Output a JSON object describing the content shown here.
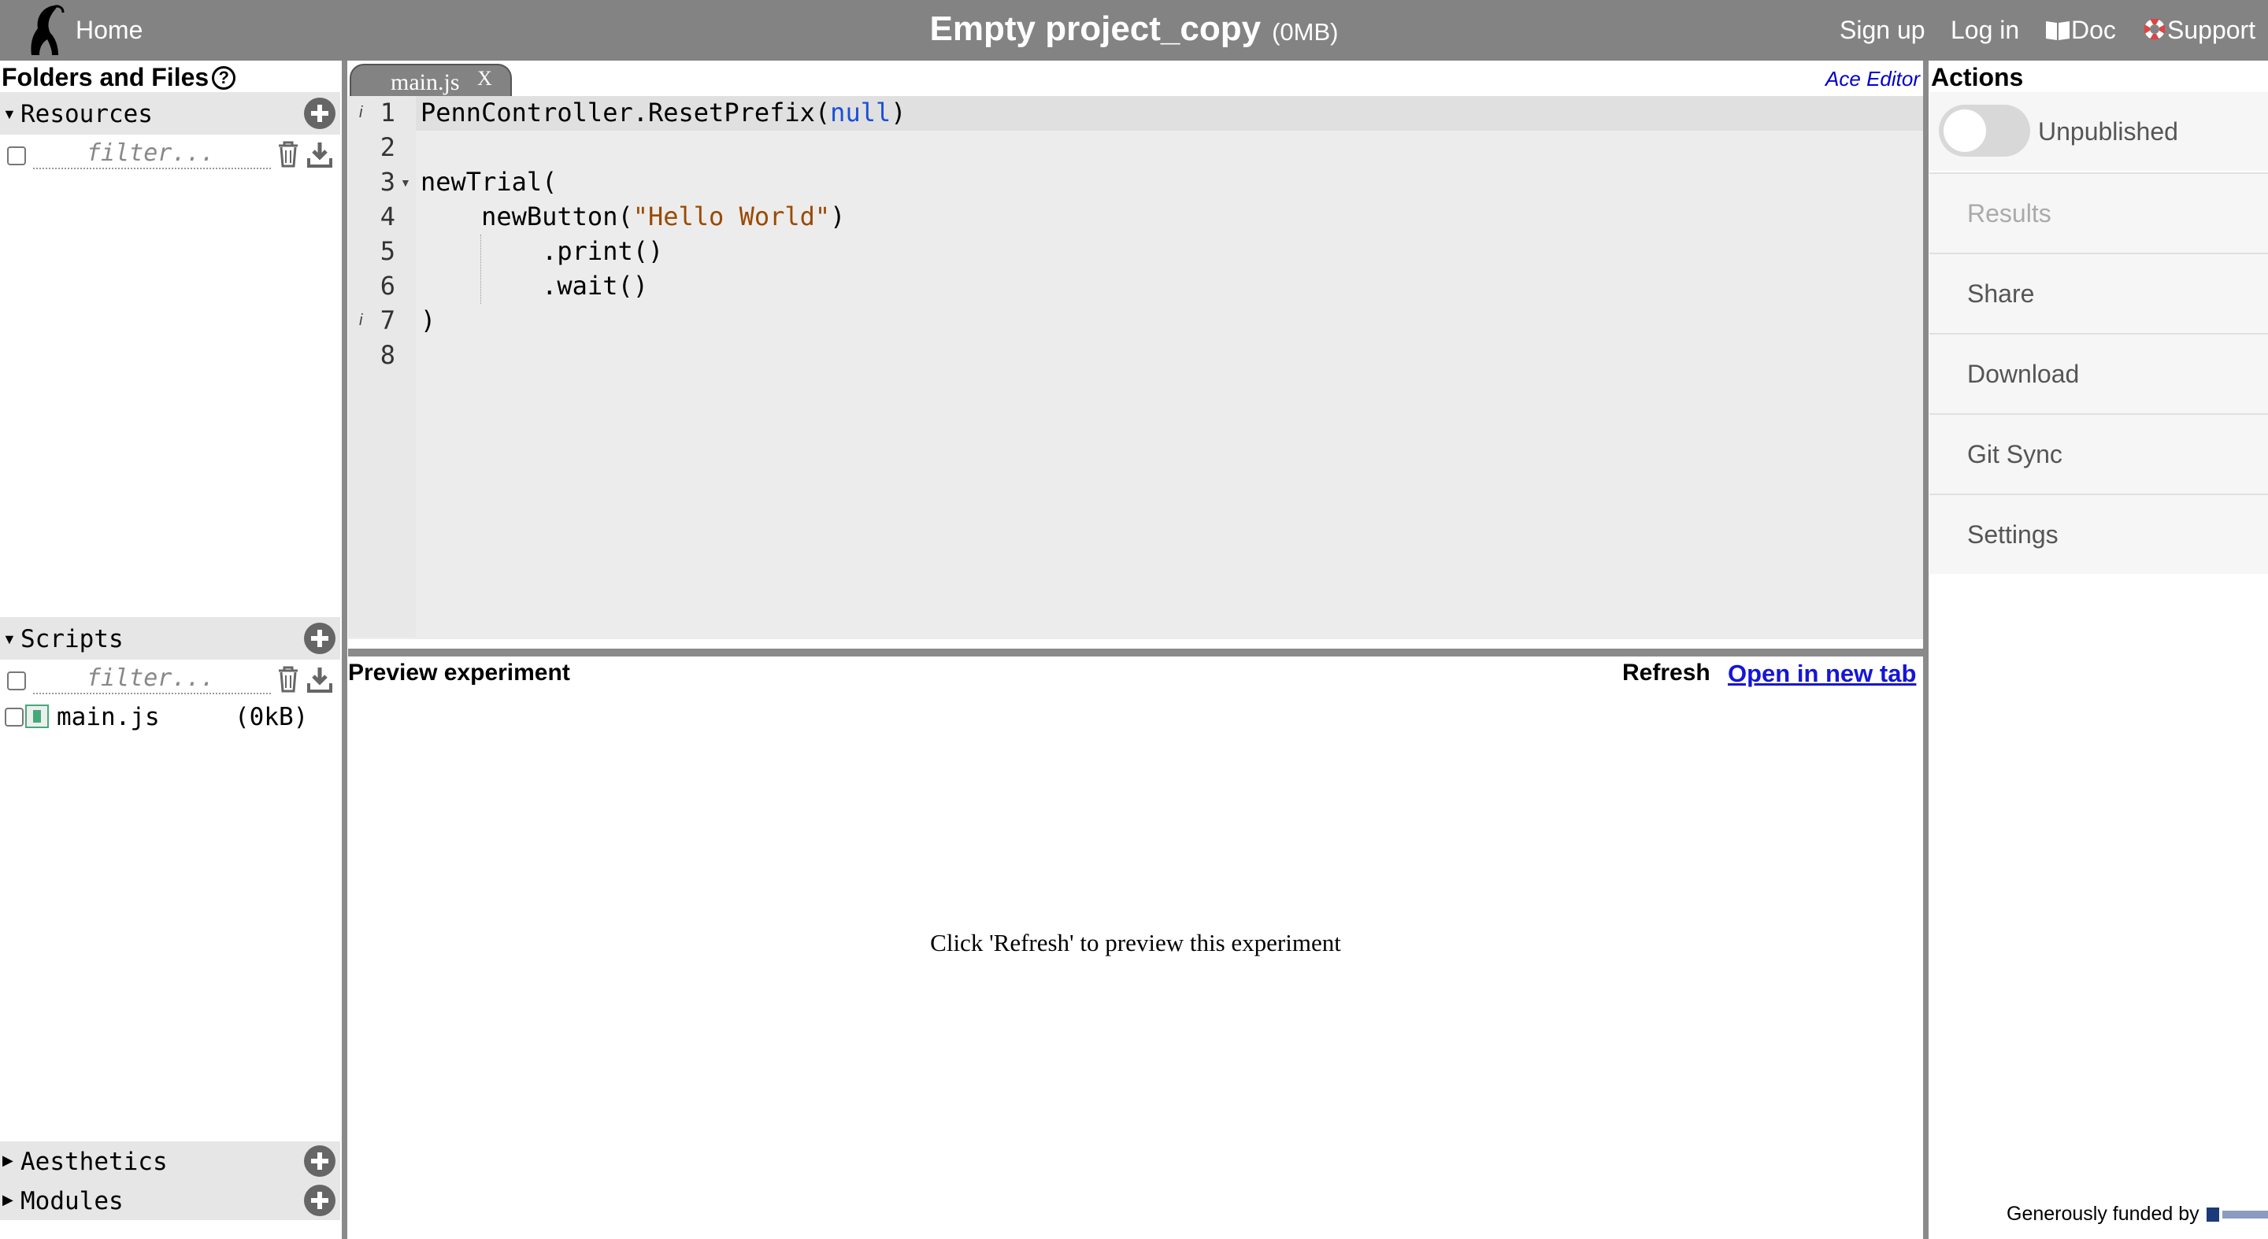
{
  "header": {
    "home_label": "Home",
    "project_title": "Empty project_copy",
    "project_size": "(0MB)",
    "signup_label": "Sign up",
    "login_label": "Log in",
    "doc_label": "Doc",
    "support_label": "Support"
  },
  "left_panel": {
    "title": "Folders and Files",
    "help_glyph": "?",
    "sections": {
      "resources": {
        "label": "Resources",
        "filter_placeholder": "filter..."
      },
      "scripts": {
        "label": "Scripts",
        "filter_placeholder": "filter...",
        "files": [
          {
            "name": "main.js",
            "size": "(0kB)"
          }
        ]
      },
      "aesthetics": {
        "label": "Aesthetics"
      },
      "modules": {
        "label": "Modules"
      }
    }
  },
  "editor": {
    "tab_label": "main.js",
    "tab_close": "X",
    "editor_label": "Ace Editor",
    "lines": [
      {
        "number": "1",
        "prefix": "PennController.ResetPrefix(",
        "keyword": "null",
        "suffix": ")"
      },
      {
        "number": "2",
        "text": ""
      },
      {
        "number": "3",
        "text": "newTrial("
      },
      {
        "number": "4",
        "prefix": "    newButton(",
        "string": "\"Hello World\"",
        "suffix": ")"
      },
      {
        "number": "5",
        "text": "        .print()"
      },
      {
        "number": "6",
        "text": "        .wait()"
      },
      {
        "number": "7",
        "text": ")"
      },
      {
        "number": "8",
        "text": ""
      }
    ]
  },
  "preview": {
    "title": "Preview experiment",
    "refresh_label": "Refresh",
    "open_new_tab_label": "Open in new tab",
    "message": "Click 'Refresh' to preview this experiment"
  },
  "actions": {
    "title": "Actions",
    "publish_status": "Unpublished",
    "publish_on": false,
    "items": [
      {
        "label": "Results",
        "disabled": true
      },
      {
        "label": "Share",
        "disabled": false
      },
      {
        "label": "Download",
        "disabled": false
      },
      {
        "label": "Git Sync",
        "disabled": false
      },
      {
        "label": "Settings",
        "disabled": false
      }
    ],
    "funded_text": "Generously funded by"
  }
}
